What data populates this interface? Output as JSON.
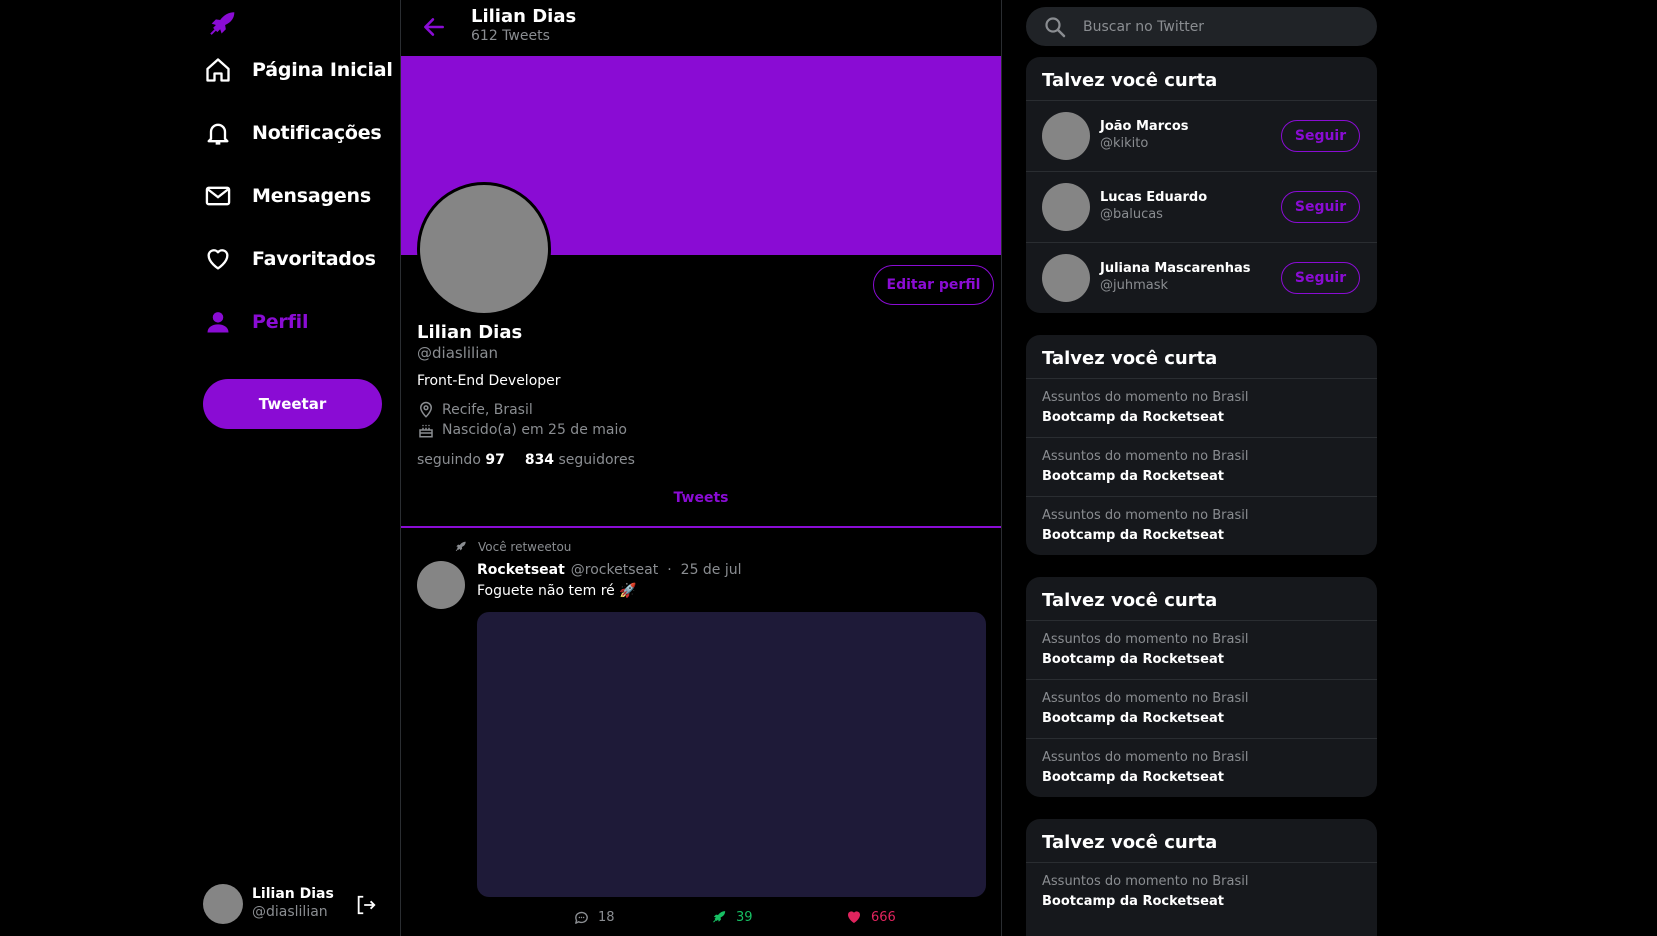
{
  "brand_color": "#8a0cd4",
  "nav": {
    "logo_icon": "rocket-icon",
    "items": [
      {
        "label": "Página Inicial",
        "icon": "home-icon"
      },
      {
        "label": "Notificações",
        "icon": "bell-icon"
      },
      {
        "label": "Mensagens",
        "icon": "mail-icon"
      },
      {
        "label": "Favoritados",
        "icon": "heart-icon"
      },
      {
        "label": "Perfil",
        "icon": "person-icon",
        "active": true
      }
    ],
    "tweet_button": "Tweetar",
    "profile": {
      "name": "Lilian Dias",
      "handle": "@diaslilian",
      "logout_icon": "logout-icon"
    }
  },
  "header": {
    "name": "Lilian Dias",
    "tweet_count": "612 Tweets"
  },
  "profile": {
    "edit_button": "Editar perfil",
    "name": "Lilian Dias",
    "handle": "@diaslilian",
    "bio": "Front-End Developer",
    "location": "Recife, Brasil",
    "birthday": "Nascido(a) em 25 de maio",
    "following_label": "seguindo",
    "following_count": "97",
    "followers_count": "834",
    "followers_label": "seguidores"
  },
  "tabs": {
    "tweets": "Tweets"
  },
  "tweet": {
    "retweet_label": "Você retweetou",
    "author": "Rocketseat",
    "handle": "@rocketseat",
    "separator": "·",
    "date": "25 de jul",
    "text": "Foguete não tem ré 🚀",
    "comments": "18",
    "retweets": "39",
    "likes": "666"
  },
  "search": {
    "placeholder": "Buscar no Twitter"
  },
  "suggestions": {
    "title": "Talvez você curta",
    "follow_label": "Seguir",
    "users": [
      {
        "name": "João Marcos",
        "handle": "@kikito"
      },
      {
        "name": "Lucas Eduardo",
        "handle": "@balucas"
      },
      {
        "name": "Juliana Mascarenhas",
        "handle": "@juhmask"
      }
    ]
  },
  "trend_cards": [
    {
      "title": "Talvez você curta",
      "items": [
        {
          "context": "Assuntos do momento no Brasil",
          "topic": "Bootcamp da Rocketseat"
        },
        {
          "context": "Assuntos do momento no Brasil",
          "topic": "Bootcamp da Rocketseat"
        },
        {
          "context": "Assuntos do momento no Brasil",
          "topic": "Bootcamp da Rocketseat"
        }
      ]
    },
    {
      "title": "Talvez você curta",
      "items": [
        {
          "context": "Assuntos do momento no Brasil",
          "topic": "Bootcamp da Rocketseat"
        },
        {
          "context": "Assuntos do momento no Brasil",
          "topic": "Bootcamp da Rocketseat"
        },
        {
          "context": "Assuntos do momento no Brasil",
          "topic": "Bootcamp da Rocketseat"
        }
      ]
    },
    {
      "title": "Talvez você curta",
      "items": [
        {
          "context": "Assuntos do momento no Brasil",
          "topic": "Bootcamp da Rocketseat"
        }
      ]
    }
  ]
}
